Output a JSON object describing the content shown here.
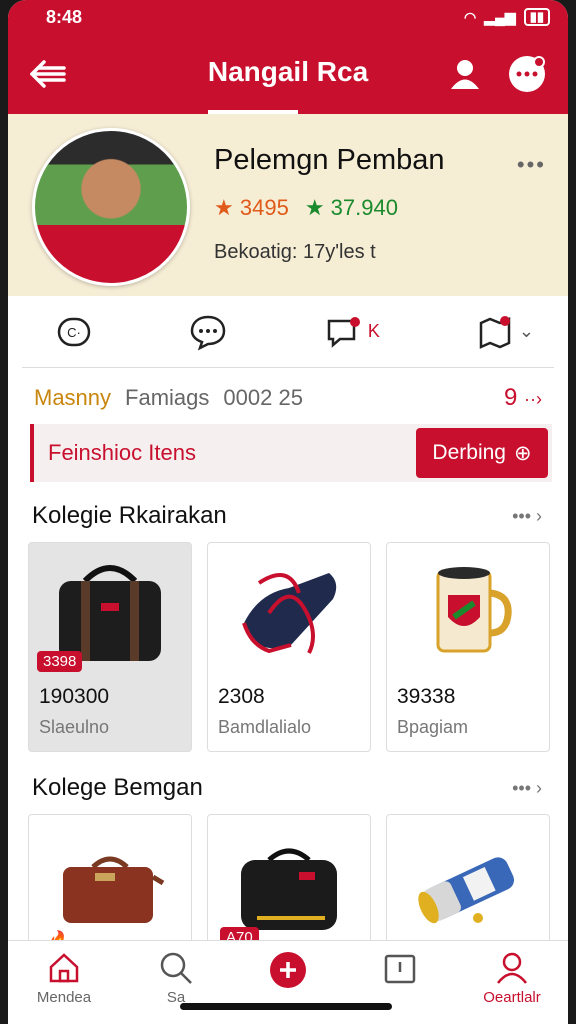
{
  "status": {
    "time": "8:48"
  },
  "header": {
    "title": "Nangail Rca"
  },
  "profile": {
    "name": "Pelemgn Pemban",
    "rating": "3495",
    "score": "37.940",
    "subtitle": "Bekoatig: 17y'les t",
    "more": "•••"
  },
  "actions": {
    "notification_label": "K"
  },
  "tabs": [
    {
      "label": "Masnny"
    },
    {
      "label": "Famiags"
    },
    {
      "label": "0002 25"
    }
  ],
  "tab_count": "9",
  "promo": {
    "label": "Feinshioc Itens",
    "button": "Derbing"
  },
  "section1": {
    "title": "Kolegie Rkairakan",
    "see_all": "•••",
    "items": [
      {
        "price": "190300",
        "category": "Slaeulno",
        "badge": "3398",
        "icon": "bag-icon"
      },
      {
        "price": "2308",
        "category": "Bamdlalialo",
        "icon": "shoe-icon"
      },
      {
        "price": "39338",
        "category": "Bpagiam",
        "icon": "mug-icon"
      }
    ]
  },
  "section2": {
    "title": "Kolege Bemgan",
    "see_all": "•••",
    "items": [
      {
        "icon": "suitcase-icon",
        "badge": "🔥"
      },
      {
        "icon": "camera-bag-icon",
        "badge": "A70"
      },
      {
        "icon": "bottle-icon"
      }
    ]
  },
  "nav": [
    {
      "label": "Mendea",
      "icon": "home-icon"
    },
    {
      "label": "Sa",
      "icon": "search-icon"
    },
    {
      "label": "",
      "icon": "add-icon"
    },
    {
      "label": "",
      "icon": "clipboard-icon"
    },
    {
      "label": "Oeartlalr",
      "icon": "profile-icon"
    }
  ],
  "colors": {
    "brand": "#c8102e",
    "profile_bg": "#f6edd5",
    "tab_active": "#c8860e"
  }
}
